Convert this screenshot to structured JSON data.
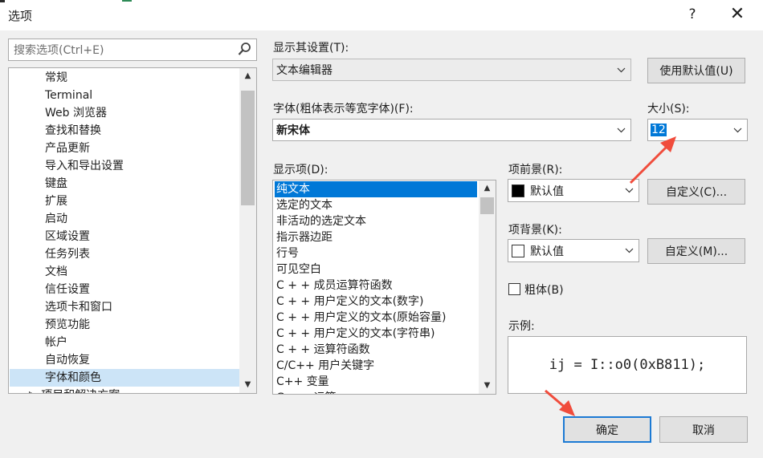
{
  "window": {
    "title": "选项",
    "help_glyph": "?",
    "close_glyph": "✕"
  },
  "search": {
    "placeholder": "搜索选项(Ctrl+E)"
  },
  "tree": {
    "items": [
      {
        "label": "常规"
      },
      {
        "label": "Terminal"
      },
      {
        "label": "Web 浏览器"
      },
      {
        "label": "查找和替换"
      },
      {
        "label": "产品更新"
      },
      {
        "label": "导入和导出设置"
      },
      {
        "label": "键盘"
      },
      {
        "label": "扩展"
      },
      {
        "label": "启动"
      },
      {
        "label": "区域设置"
      },
      {
        "label": "任务列表"
      },
      {
        "label": "文档"
      },
      {
        "label": "信任设置"
      },
      {
        "label": "选项卡和窗口"
      },
      {
        "label": "预览功能"
      },
      {
        "label": "帐户"
      },
      {
        "label": "自动恢复"
      },
      {
        "label": "字体和颜色"
      }
    ],
    "selected_label": "字体和颜色",
    "partial_label": "▷ 项目和解决方案"
  },
  "settings": {
    "label": "显示其设置(T):",
    "value": "文本编辑器",
    "reset_button": "使用默认值(U)"
  },
  "font": {
    "label": "字体(粗体表示等宽字体)(F):",
    "value": "新宋体"
  },
  "size": {
    "label": "大小(S):",
    "value": "12"
  },
  "display_items": {
    "label": "显示项(D):",
    "items": [
      {
        "label": "纯文本"
      },
      {
        "label": "选定的文本"
      },
      {
        "label": "非活动的选定文本"
      },
      {
        "label": "指示器边距"
      },
      {
        "label": "行号"
      },
      {
        "label": "可见空白"
      },
      {
        "label": "C + + 成员运算符函数"
      },
      {
        "label": "C + + 用户定义的文本(数字)"
      },
      {
        "label": "C + + 用户定义的文本(原始容量)"
      },
      {
        "label": "C + + 用户定义的文本(字符串)"
      },
      {
        "label": "C + + 运算符函数"
      },
      {
        "label": "C/C++ 用户关键字"
      },
      {
        "label": "C++ 变量"
      }
    ],
    "selected_label": "纯文本",
    "partial_label": "C + + 运算"
  },
  "foreground": {
    "label": "项前景(R):",
    "value": "默认值",
    "color": "#000000",
    "custom_button": "自定义(C)..."
  },
  "background": {
    "label": "项背景(K):",
    "value": "默认值",
    "color": "#ffffff",
    "custom_button": "自定义(M)..."
  },
  "bold": {
    "label": "粗体(B)",
    "checked": false
  },
  "sample": {
    "label": "示例:",
    "text": "ij = I::o0(0xB811);"
  },
  "footer": {
    "ok": "确定",
    "cancel": "取消"
  },
  "colors": {
    "accent": "#0078d7",
    "selection": "#cce4f7",
    "annotation_arrow": "#f04c3c"
  },
  "icons": [
    "search-icon",
    "close-icon",
    "help-icon",
    "chevron-down-icon",
    "scroll-up-icon",
    "scroll-down-icon"
  ]
}
